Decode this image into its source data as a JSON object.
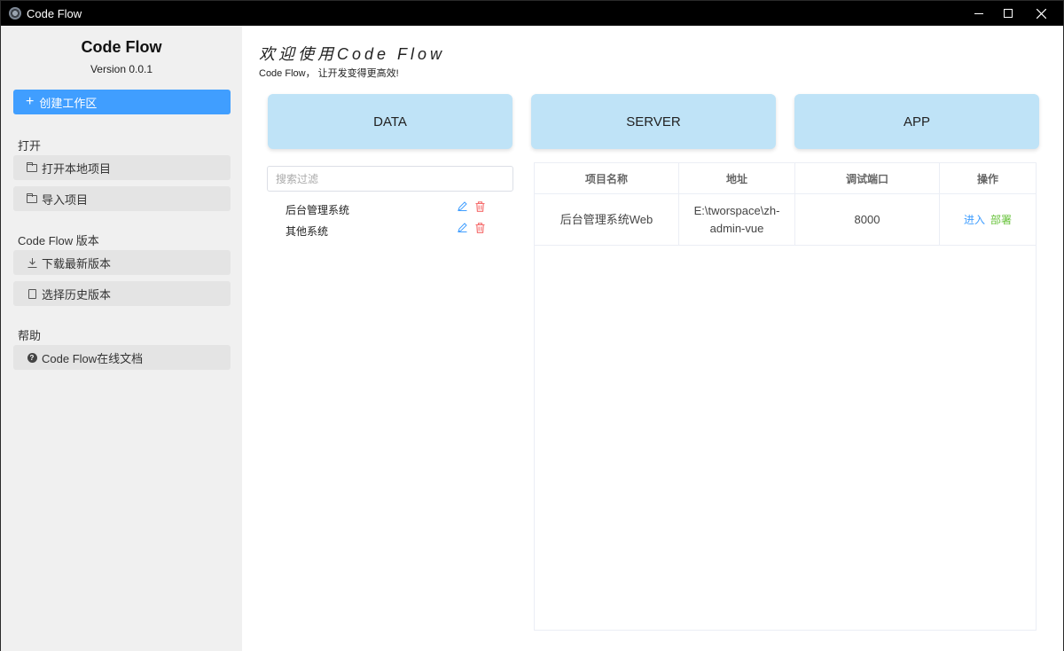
{
  "window": {
    "title": "Code Flow"
  },
  "sidebar": {
    "brand": "Code Flow",
    "version": "Version 0.0.1",
    "create_label": "创建工作区",
    "sections": {
      "open_label": "打开",
      "version_label": "Code Flow 版本",
      "help_label": "帮助"
    },
    "items": {
      "open_local": "打开本地项目",
      "import_project": "导入项目",
      "download_latest": "下载最新版本",
      "choose_history": "选择历史版本",
      "online_docs": "Code Flow在线文档"
    },
    "icons": {
      "create": "plus-icon",
      "open_local": "folder-icon",
      "import_project": "folder-import-icon",
      "download_latest": "download-icon",
      "choose_history": "document-icon",
      "online_docs": "help-icon"
    }
  },
  "main": {
    "welcome": "欢迎使用Code Flow",
    "slogan": "Code Flow， 让开发变得更高效!",
    "categories": [
      "DATA",
      "SERVER",
      "APP"
    ],
    "search": {
      "placeholder": "搜索过滤",
      "value": ""
    },
    "tree": [
      "后台管理系统",
      "其他系统"
    ],
    "table": {
      "headers": [
        "项目名称",
        "地址",
        "调试端口",
        "操作"
      ],
      "rows": [
        {
          "name": "后台管理系统Web",
          "path": "E:\\tworspace\\zh-admin-vue",
          "port": "8000",
          "enter": "进入",
          "deploy": "部署"
        }
      ]
    }
  },
  "colors": {
    "primary": "#409eff",
    "success": "#67c23a",
    "danger": "#f56c6c",
    "card": "#bfe3f7",
    "sidebar": "#f0f0f0"
  }
}
